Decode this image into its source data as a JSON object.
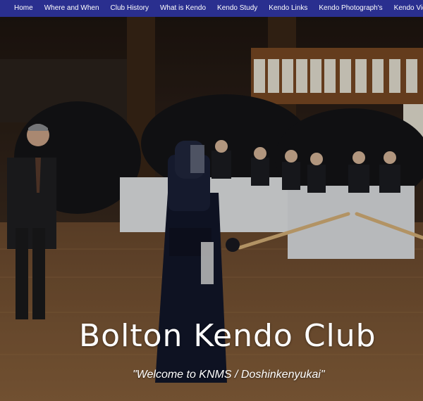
{
  "nav": {
    "items": [
      "Home",
      "Where and When",
      "Club History",
      "What is Kendo",
      "Kendo Study",
      "Kendo Links",
      "Kendo Photograph's",
      "Kendo Videos"
    ]
  },
  "hero": {
    "title": "Bolton Kendo Club",
    "subtitle": "\"Welcome to KNMS / Doshinkenyukai\""
  },
  "colors": {
    "nav_bg": "#2a2f8f",
    "nav_text": "#ffffff",
    "title_text": "#ffffff"
  }
}
